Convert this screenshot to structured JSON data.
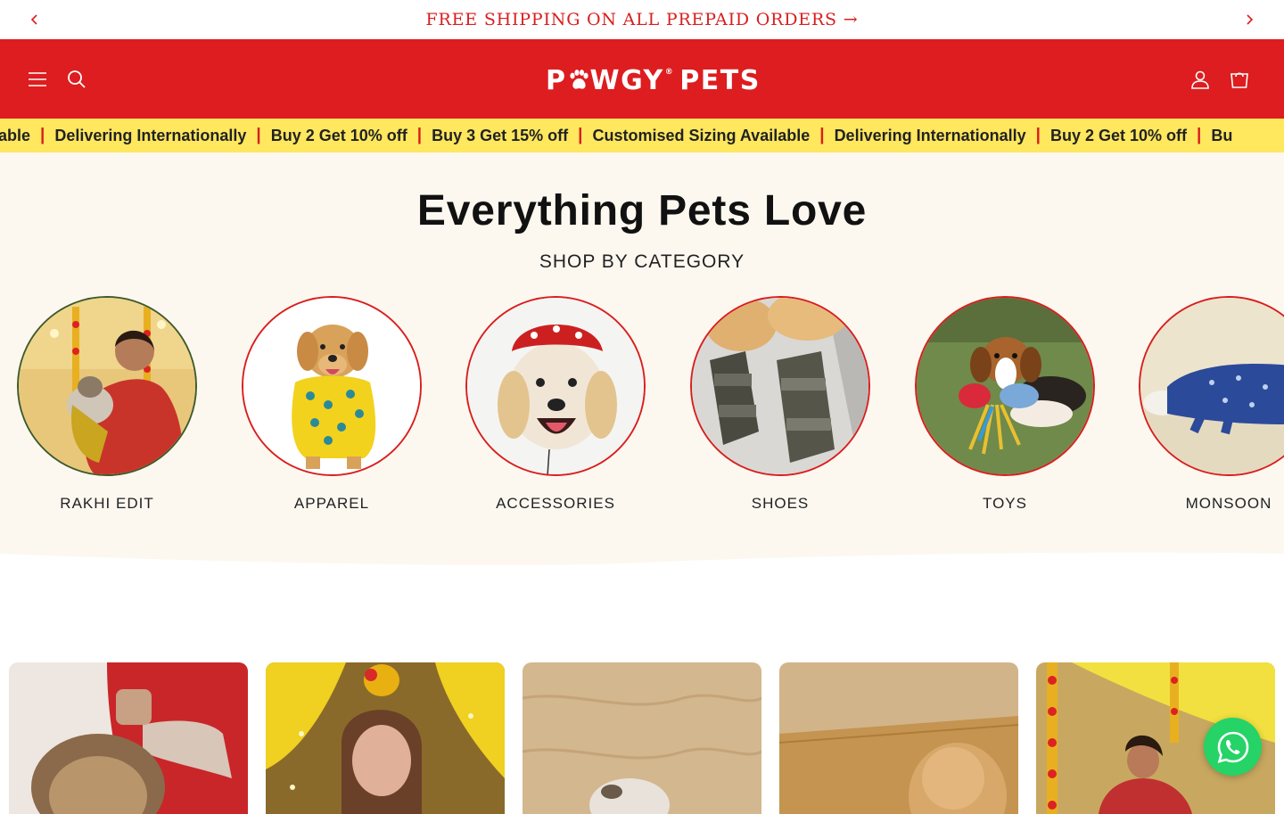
{
  "announcement": {
    "text": "FREE SHIPPING ON ALL PREPAID ORDERS →",
    "prev_icon": "chevron-left-icon",
    "next_icon": "chevron-right-icon"
  },
  "header": {
    "logo_text_a": "P",
    "logo_text_b": "WGY",
    "logo_reg": "®",
    "logo_text_c": "PETS",
    "logo_full": "PAWGY PETS",
    "icons": [
      "menu-icon",
      "search-icon",
      "account-icon",
      "cart-icon"
    ]
  },
  "marquee": {
    "items": [
      "able",
      "Delivering Internationally",
      "Buy 2 Get 10% off",
      "Buy 3 Get 15% off",
      "Customised Sizing Available",
      "Delivering Internationally",
      "Buy 2 Get 10% off",
      "Bu"
    ],
    "separator": "|"
  },
  "categories": {
    "title": "Everything Pets Love",
    "subtitle": "SHOP BY CATEGORY",
    "items": [
      {
        "label": "RAKHI EDIT"
      },
      {
        "label": "APPAREL"
      },
      {
        "label": "ACCESSORIES"
      },
      {
        "label": "SHOES"
      },
      {
        "label": "TOYS"
      },
      {
        "label": "MONSOON"
      }
    ]
  },
  "products": {
    "count_visible": 5
  },
  "colors": {
    "brand_red": "#dd1d1f",
    "marquee_yellow": "#ffe75e",
    "section_bg": "#fcf8f0",
    "whatsapp_green": "#25d366"
  }
}
